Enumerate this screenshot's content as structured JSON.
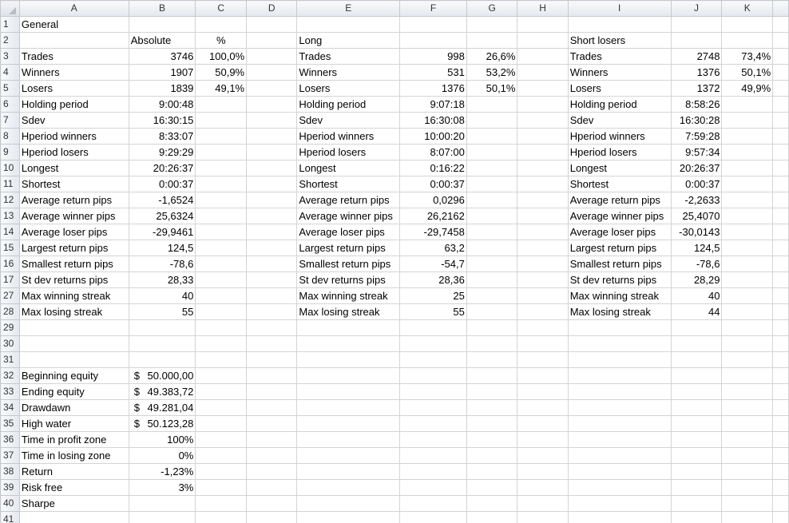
{
  "columns": [
    "A",
    "B",
    "C",
    "D",
    "E",
    "F",
    "G",
    "H",
    "I",
    "J",
    "K"
  ],
  "rows": [
    {
      "n": "1",
      "A": "General"
    },
    {
      "n": "2",
      "B": "Absolute",
      "C": "%",
      "E": "Long",
      "I": "Short losers"
    },
    {
      "n": "3",
      "A": "Trades",
      "B": "3746",
      "C": "100,0%",
      "E": "Trades",
      "F": "998",
      "G": "26,6%",
      "I": "Trades",
      "J": "2748",
      "K": "73,4%"
    },
    {
      "n": "4",
      "A": "Winners",
      "B": "1907",
      "C": "50,9%",
      "E": "Winners",
      "F": "531",
      "G": "53,2%",
      "I": "Winners",
      "J": "1376",
      "K": "50,1%"
    },
    {
      "n": "5",
      "A": "Losers",
      "B": "1839",
      "C": "49,1%",
      "E": "Losers",
      "F": "1376",
      "G": "50,1%",
      "I": "Losers",
      "J": "1372",
      "K": "49,9%"
    },
    {
      "n": "6",
      "A": "Holding period",
      "B": "9:00:48",
      "E": "Holding period",
      "F": "9:07:18",
      "I": "Holding period",
      "J": "8:58:26"
    },
    {
      "n": "7",
      "A": "Sdev",
      "B": "16:30:15",
      "E": "Sdev",
      "F": "16:30:08",
      "I": "Sdev",
      "J": "16:30:28"
    },
    {
      "n": "8",
      "A": "Hperiod winners",
      "B": "8:33:07",
      "E": "Hperiod winners",
      "F": "10:00:20",
      "I": "Hperiod winners",
      "J": "7:59:28"
    },
    {
      "n": "9",
      "A": "Hperiod losers",
      "B": "9:29:29",
      "E": "Hperiod losers",
      "F": "8:07:00",
      "I": "Hperiod losers",
      "J": "9:57:34"
    },
    {
      "n": "10",
      "A": "Longest",
      "B": "20:26:37",
      "E": "Longest",
      "F": "0:16:22",
      "I": "Longest",
      "J": "20:26:37"
    },
    {
      "n": "11",
      "A": "Shortest",
      "B": "0:00:37",
      "E": "Shortest",
      "F": "0:00:37",
      "I": "Shortest",
      "J": "0:00:37"
    },
    {
      "n": "12",
      "A": "Average return pips",
      "B": "-1,6524",
      "E": "Average return pips",
      "F": "0,0296",
      "I": "Average return pips",
      "J": "-2,2633"
    },
    {
      "n": "13",
      "A": "Average winner pips",
      "B": "25,6324",
      "E": "Average winner pips",
      "F": "26,2162",
      "I": "Average winner pips",
      "J": "25,4070"
    },
    {
      "n": "14",
      "A": "Average loser pips",
      "B": "-29,9461",
      "E": "Average loser pips",
      "F": "-29,7458",
      "I": "Average loser pips",
      "J": "-30,0143"
    },
    {
      "n": "15",
      "A": "Largest return pips",
      "B": "124,5",
      "E": "Largest return pips",
      "F": "63,2",
      "I": "Largest return pips",
      "J": "124,5"
    },
    {
      "n": "16",
      "A": "Smallest return pips",
      "B": "-78,6",
      "E": "Smallest return pips",
      "F": "-54,7",
      "I": "Smallest return pips",
      "J": "-78,6"
    },
    {
      "n": "17",
      "A": "St dev returns pips",
      "B": "28,33",
      "E": "St dev returns pips",
      "F": "28,36",
      "I": "St dev returns pips",
      "J": "28,29"
    },
    {
      "n": "27",
      "A": "Max winning streak",
      "B": "40",
      "E": "Max winning streak",
      "F": "25",
      "I": "Max winning streak",
      "J": "40"
    },
    {
      "n": "28",
      "A": "Max losing streak",
      "B": "55",
      "E": "Max losing streak",
      "F": "55",
      "I": "Max losing streak",
      "J": "44"
    },
    {
      "n": "29"
    },
    {
      "n": "30"
    },
    {
      "n": "31"
    },
    {
      "n": "32",
      "A": "Beginning equity",
      "B_sym": "$",
      "B_val": "50.000,00"
    },
    {
      "n": "33",
      "A": "Ending equity",
      "B_sym": "$",
      "B_val": "49.383,72"
    },
    {
      "n": "34",
      "A": "Drawdawn",
      "B_sym": "$",
      "B_val": "49.281,04"
    },
    {
      "n": "35",
      "A": "High water",
      "B_sym": "$",
      "B_val": "50.123,28"
    },
    {
      "n": "36",
      "A": "Time in profit zone",
      "B": "100%"
    },
    {
      "n": "37",
      "A": "Time in losing zone",
      "B": "0%"
    },
    {
      "n": "38",
      "A": "Return",
      "B": "-1,23%"
    },
    {
      "n": "39",
      "A": "Risk free",
      "B": "3%"
    },
    {
      "n": "40",
      "A": "Sharpe"
    },
    {
      "n": "41"
    }
  ]
}
